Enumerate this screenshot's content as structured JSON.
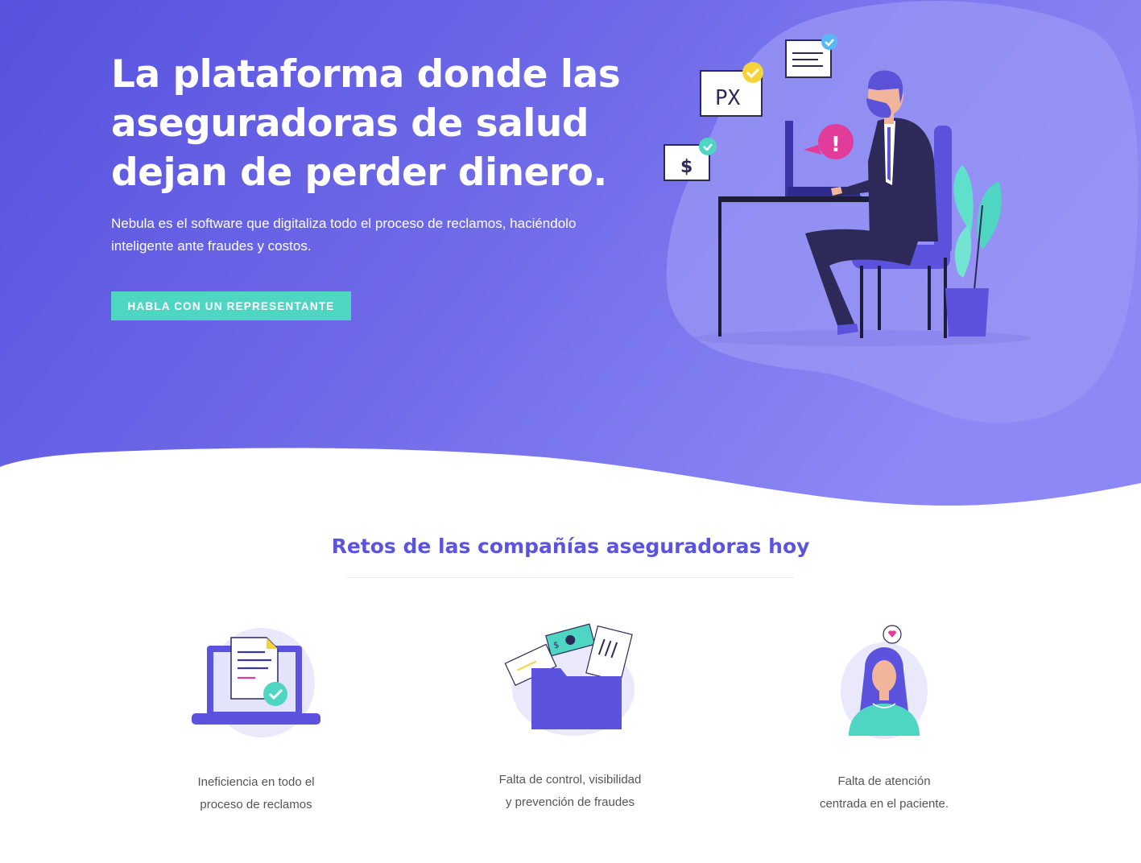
{
  "hero": {
    "title_line1": "La plataforma donde las",
    "title_line2": "aseguradoras de salud",
    "title_line3": "dejan de perder dinero.",
    "subtitle_line1": "Nebula es el software que digitaliza todo el proceso de reclamos, haciéndolo",
    "subtitle_line2": "inteligente ante fraudes y costos.",
    "cta_label": "HABLA CON UN REPRESENTANTE",
    "illustration": {
      "doc1_text": "PX",
      "doc2_text": "$",
      "alert_text": "!"
    }
  },
  "challenges": {
    "title": "Retos de las compañías aseguradoras hoy",
    "items": [
      {
        "icon": "laptop-document-check-icon",
        "line1": "Ineficiencia en todo el",
        "line2": "proceso de reclamos"
      },
      {
        "icon": "folder-papers-icon",
        "line1": "Falta de control, visibilidad",
        "line2": "y prevención de fraudes"
      },
      {
        "icon": "patient-heart-icon",
        "line1": "Falta de atención",
        "line2": "centrada en el paciente."
      }
    ]
  },
  "colors": {
    "hero_gradient_start": "#5a55e0",
    "hero_gradient_end": "#8b86f5",
    "accent_teal": "#4fd6c3",
    "title_purple": "#5b54e0"
  }
}
